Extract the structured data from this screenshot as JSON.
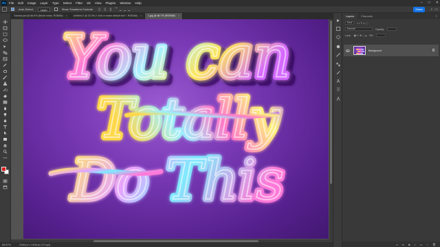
{
  "app": {
    "logo": "Ps"
  },
  "menu": [
    "File",
    "Edit",
    "Image",
    "Layer",
    "Type",
    "Select",
    "Filter",
    "3D",
    "View",
    "Plugins",
    "Window",
    "Help"
  ],
  "window_controls": [
    "–",
    "□",
    "✕"
  ],
  "options": {
    "auto_select_label": "Auto-Select:",
    "auto_select_value": "Layer",
    "transform_label": "Show Transform Controls",
    "share_label": "Share"
  },
  "tabs": [
    {
      "label": "Tutorial.psd @ 66.6% (Brush noise, RGB/8#)",
      "active": false
    },
    {
      "label": "Untitled-2 @ 33.3% (* Add or erase default text *, RGB/8#)",
      "active": false
    },
    {
      "label": "1.jpg @ 66.7% (RGB/8#)",
      "active": true
    }
  ],
  "status": {
    "zoom": "66.67%",
    "doc_info": "1948 px x 1406 px (72 ppi)"
  },
  "layers_panel": {
    "tabs": [
      "Layers",
      "Channels"
    ],
    "kind_label": "Kind",
    "blend_mode": "Normal",
    "opacity_label": "Opacity:",
    "lock_label": "Lock:",
    "fill_label": "Fill:",
    "layer_name": "Background"
  },
  "artwork": {
    "line1": "You can",
    "line2": "Totally",
    "line3": "Do This"
  }
}
